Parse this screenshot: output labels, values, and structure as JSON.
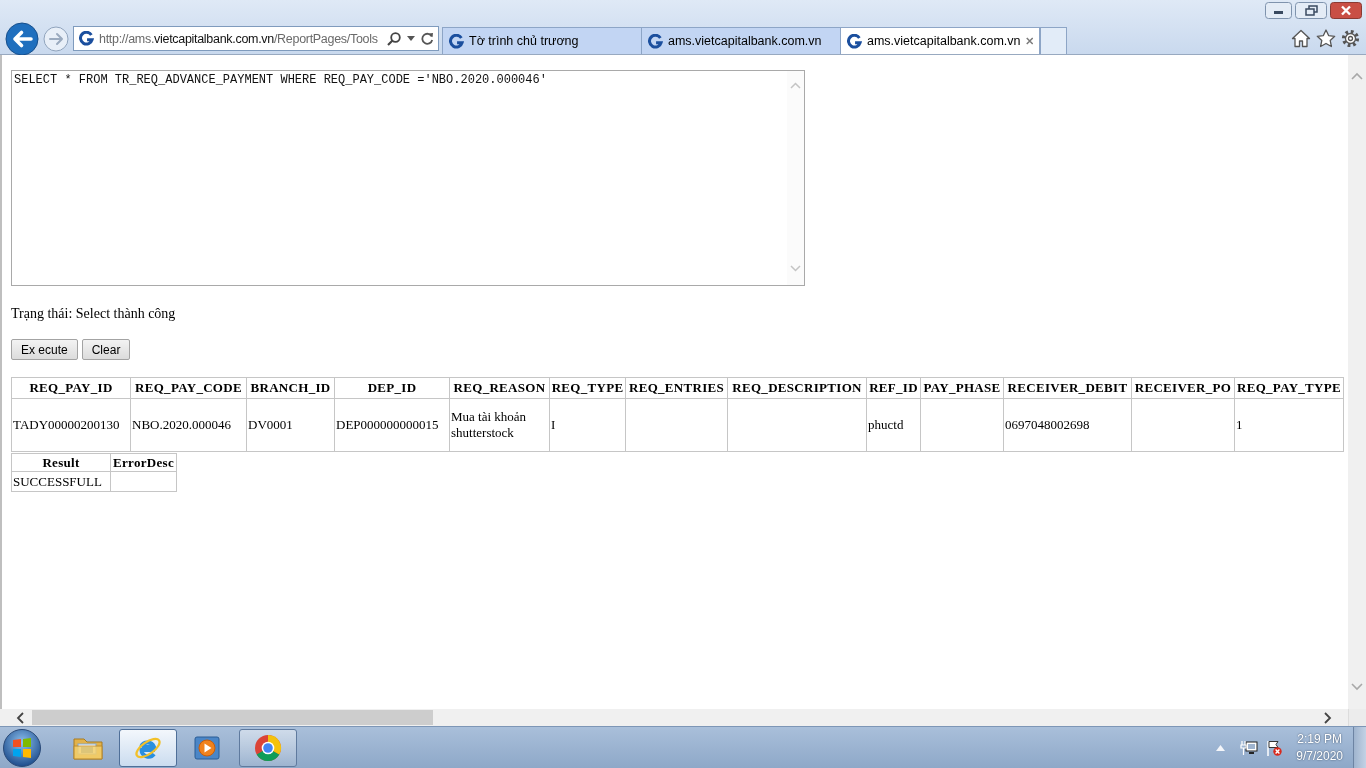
{
  "browser": {
    "address_bar": {
      "url": [
        {
          "text": "http://ams.",
          "kind": "dim"
        },
        {
          "text": "vietcapitalbank.com.vn",
          "kind": "host"
        },
        {
          "text": "/ReportPages/Tools",
          "kind": "dim"
        }
      ]
    },
    "tabs": [
      {
        "label": "Tờ trình chủ trương",
        "selected": false
      },
      {
        "label": "ams.vietcapitalbank.com.vn",
        "selected": false
      },
      {
        "label": "ams.vietcapitalbank.com.vn",
        "selected": true
      }
    ]
  },
  "page": {
    "query": {
      "value": "SELECT * FROM TR_REQ_ADVANCE_PAYMENT WHERE REQ_PAY_CODE ='NBO.2020.000046'"
    },
    "status": "Trạng thái: Select thành công",
    "buttons": [
      "Ex ecute",
      "Clear"
    ],
    "result_table": {
      "columns": [
        "REQ_PAY_ID",
        "REQ_PAY_CODE",
        "BRANCH_ID",
        "DEP_ID",
        "REQ_REASON",
        "REQ_TYPE",
        "REQ_ENTRIES",
        "REQ_DESCRIPTION",
        "REF_ID",
        "PAY_PHASE",
        "RECEIVER_DEBIT",
        "RECEIVER_PO",
        "REQ_PAY_TYPE"
      ],
      "rows": [
        [
          "TADY00000200130",
          "NBO.2020.000046",
          "DV0001",
          "DEP000000000015",
          "Mua tài khoản shutterstock",
          "I",
          null,
          null,
          "phuctd",
          null,
          "0697048002698",
          null,
          "1"
        ]
      ]
    },
    "summary_table": {
      "columns": [
        "Result",
        "ErrorDesc"
      ],
      "rows": [
        [
          "SUCCESSFULL",
          null
        ]
      ]
    }
  },
  "taskbar": {
    "items": [
      {
        "kind": "folder",
        "running": false,
        "selected": false
      },
      {
        "kind": "e-logo",
        "running": true,
        "selected": true
      },
      {
        "kind": "play",
        "running": false,
        "selected": false
      },
      {
        "kind": "ring-logo",
        "running": true,
        "selected": false
      }
    ],
    "clock": {
      "time": "2:19 PM",
      "date": "9/7/2020"
    }
  }
}
